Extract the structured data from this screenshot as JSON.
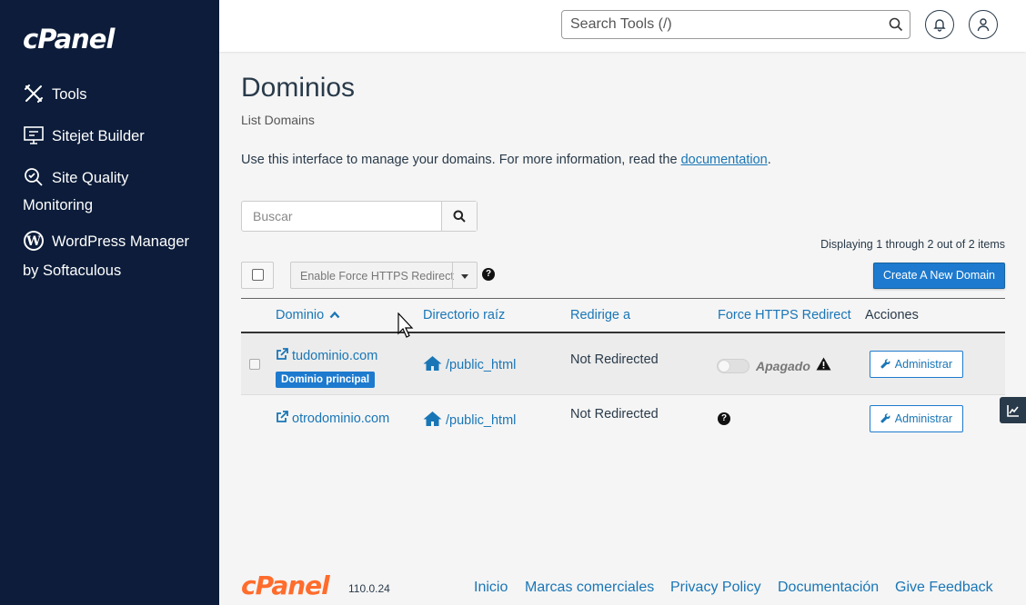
{
  "sidebar": {
    "brand": "cPanel",
    "items": [
      {
        "label": "Tools",
        "icon": "tools-icon"
      },
      {
        "label": "Sitejet Builder",
        "icon": "monitor-icon"
      },
      {
        "label": "Site Quality",
        "label2": "Monitoring",
        "icon": "site-quality-icon"
      },
      {
        "label": "WordPress Manager",
        "label2": "by Softaculous",
        "icon": "wordpress-icon"
      }
    ]
  },
  "header": {
    "search_placeholder": "Search Tools (/)"
  },
  "page": {
    "title": "Dominios",
    "subtitle": "List Domains",
    "intro_text": "Use this interface to manage your domains. For more information, read the",
    "intro_link": "documentation",
    "intro_end": "."
  },
  "toolbar": {
    "search_placeholder": "Buscar",
    "displaying": "Displaying 1 through 2 out of 2 items",
    "https_button": "Enable Force HTTPS Redirect",
    "create_button": "Create A New Domain"
  },
  "table": {
    "headers": {
      "domain": "Dominio",
      "root": "Directorio raíz",
      "redirect": "Redirige a",
      "https": "Force HTTPS Redirect",
      "actions": "Acciones"
    },
    "rows": [
      {
        "domain": "tudominio.com",
        "badge": "Dominio principal",
        "root": "/public_html",
        "redirect": "Not Redirected",
        "https_status": "Apagado",
        "action": "Administrar"
      },
      {
        "domain": "otrodominio.com",
        "root": "/public_html",
        "redirect": "Not Redirected",
        "action": "Administrar"
      }
    ]
  },
  "footer": {
    "brand": "cPanel",
    "version": "110.0.24",
    "links": [
      "Inicio",
      "Marcas comerciales",
      "Privacy Policy",
      "Documentación",
      "Give Feedback"
    ]
  },
  "colors": {
    "sidebar_bg": "#0c1c3a",
    "accent": "#1d7ace",
    "brand_orange": "#ff6c2c"
  }
}
